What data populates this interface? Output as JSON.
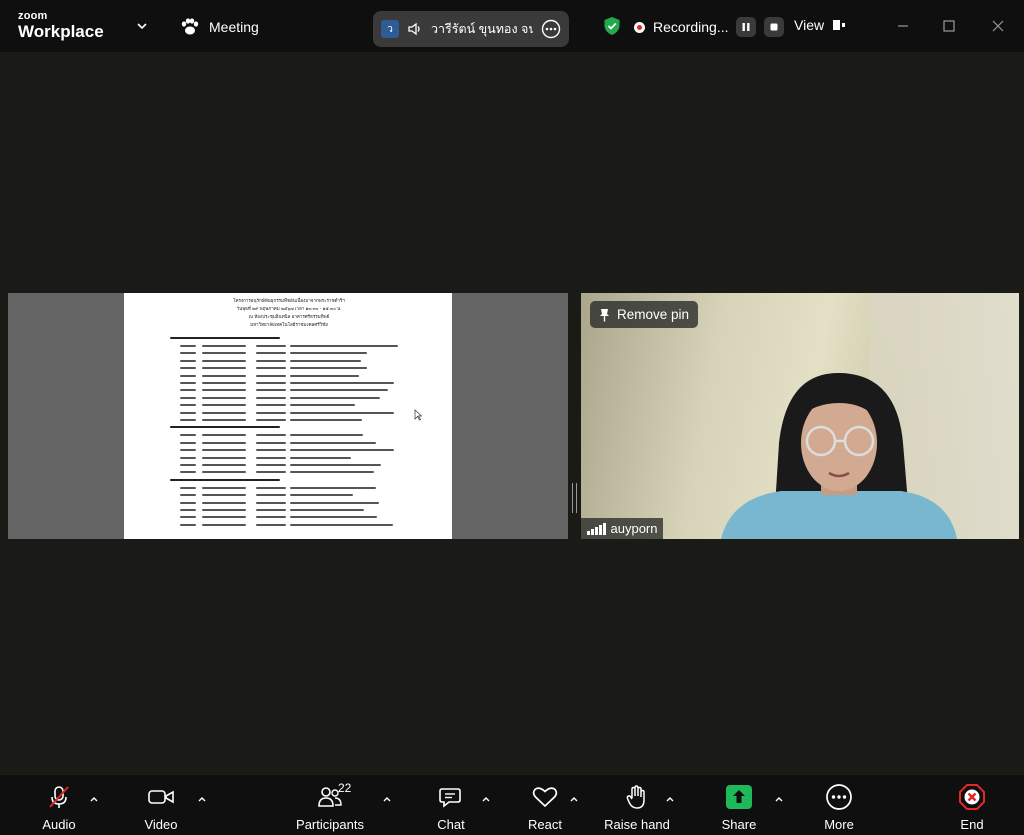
{
  "app": {
    "brand_top": "zoom",
    "brand_bottom": "Workplace"
  },
  "titlebar": {
    "meeting_label": "Meeting",
    "active_speaker": {
      "avatar_letter": "ว",
      "name": "วารีรัตน์ ขุนทอง จนแ"
    },
    "recording_label": "Recording...",
    "view_label": "View"
  },
  "share": {
    "doc_lines": [
      "โครงการอนุรักษ์พันธุกรรมพืชอันเนื่องมาจากพระราชดำริฯ",
      "วันพุธที่ ๒๙ พฤษภาคม ๒๕๖๗ เวลา ๑๓.๓๐ - ๑๕.๓๐ น.",
      "ณ ห้องประชุมอินทนิล อาคารศรีธรรมทิพย์",
      "มหาวิทยาลัยเทคโนโลยีราชมงคลศรีวิชัย"
    ]
  },
  "video": {
    "pin_label": "Remove pin",
    "participant_name": "auyporn"
  },
  "toolbar": {
    "audio_label": "Audio",
    "video_label": "Video",
    "participants_label": "Participants",
    "participants_count": "22",
    "chat_label": "Chat",
    "react_label": "React",
    "raise_hand_label": "Raise hand",
    "share_label": "Share",
    "more_label": "More",
    "end_label": "End"
  },
  "colors": {
    "background": "#1a1a16",
    "toolbar": "#0f0f0f",
    "share_green": "#1fb85a",
    "end_red": "#e02828",
    "shield_green": "#23a84e"
  }
}
